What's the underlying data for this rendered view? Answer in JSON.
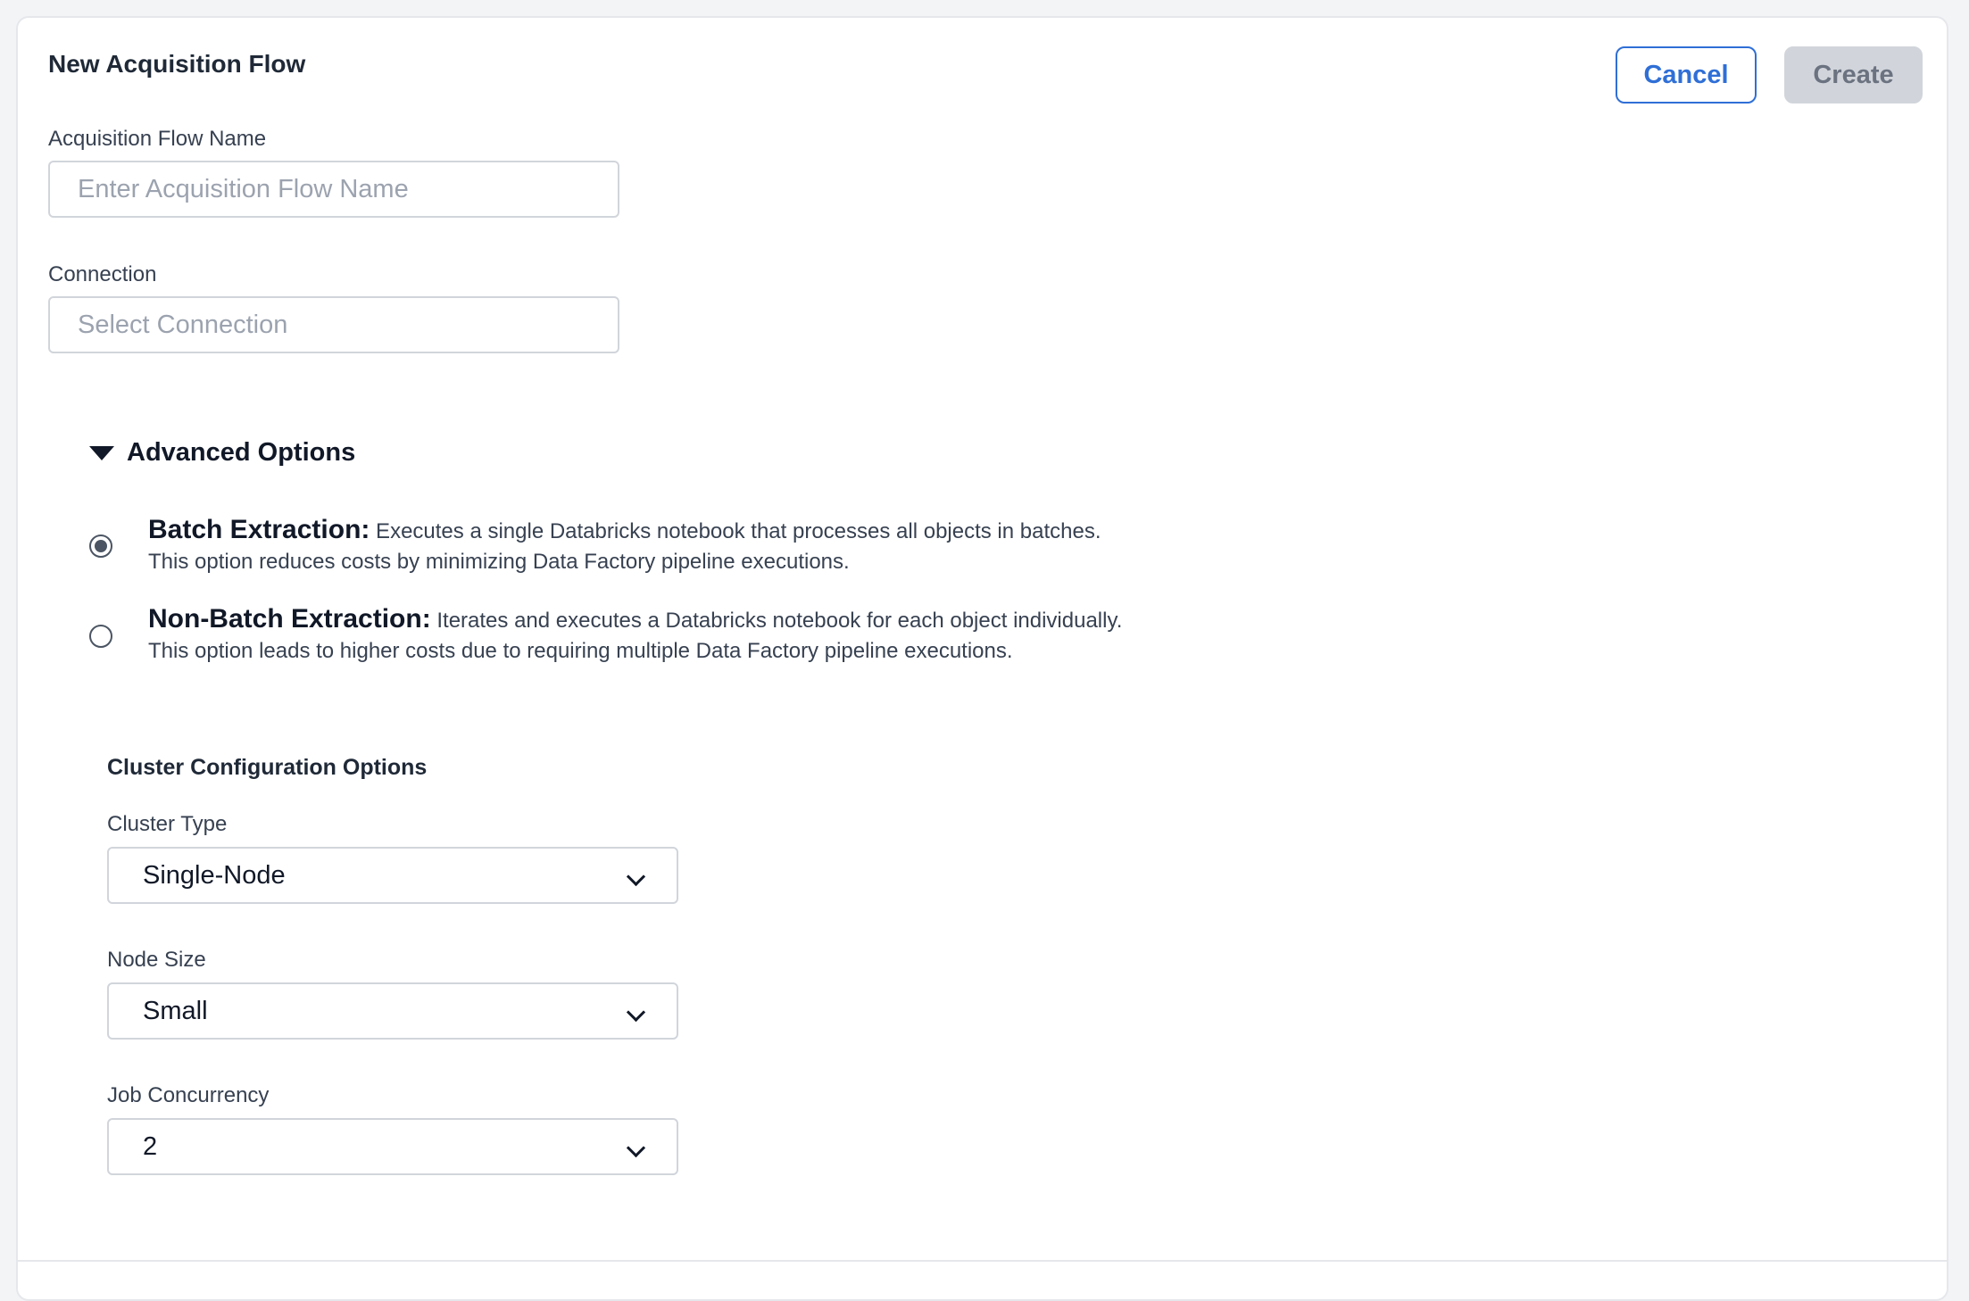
{
  "header": {
    "title": "New Acquisition Flow",
    "cancel_label": "Cancel",
    "create_label": "Create"
  },
  "form": {
    "flow_name": {
      "label": "Acquisition Flow Name",
      "placeholder": "Enter Acquisition Flow Name",
      "value": ""
    },
    "connection": {
      "label": "Connection",
      "placeholder": "Select Connection",
      "value": ""
    }
  },
  "advanced": {
    "toggle_label": "Advanced Options",
    "expanded": true,
    "options": [
      {
        "title": "Batch Extraction:",
        "line1": " Executes a single Databricks notebook that processes all objects in batches.",
        "line2": "This option reduces costs by minimizing Data Factory pipeline executions.",
        "selected": true
      },
      {
        "title": "Non-Batch Extraction:",
        "line1": " Iterates and executes a Databricks notebook for each object individually.",
        "line2": "This option leads to higher costs due to requiring multiple Data Factory pipeline executions.",
        "selected": false
      }
    ]
  },
  "cluster": {
    "section_title": "Cluster Configuration Options",
    "cluster_type": {
      "label": "Cluster Type",
      "value": "Single-Node"
    },
    "node_size": {
      "label": "Node Size",
      "value": "Small"
    },
    "job_concurrency": {
      "label": "Job Concurrency",
      "value": "2"
    }
  },
  "colors": {
    "accent": "#2f6fd6",
    "disabled_button": "#d1d5db",
    "border": "#d1d5db"
  },
  "icons": [
    "caret-down-icon",
    "chevron-down-icon",
    "radio-icon"
  ]
}
